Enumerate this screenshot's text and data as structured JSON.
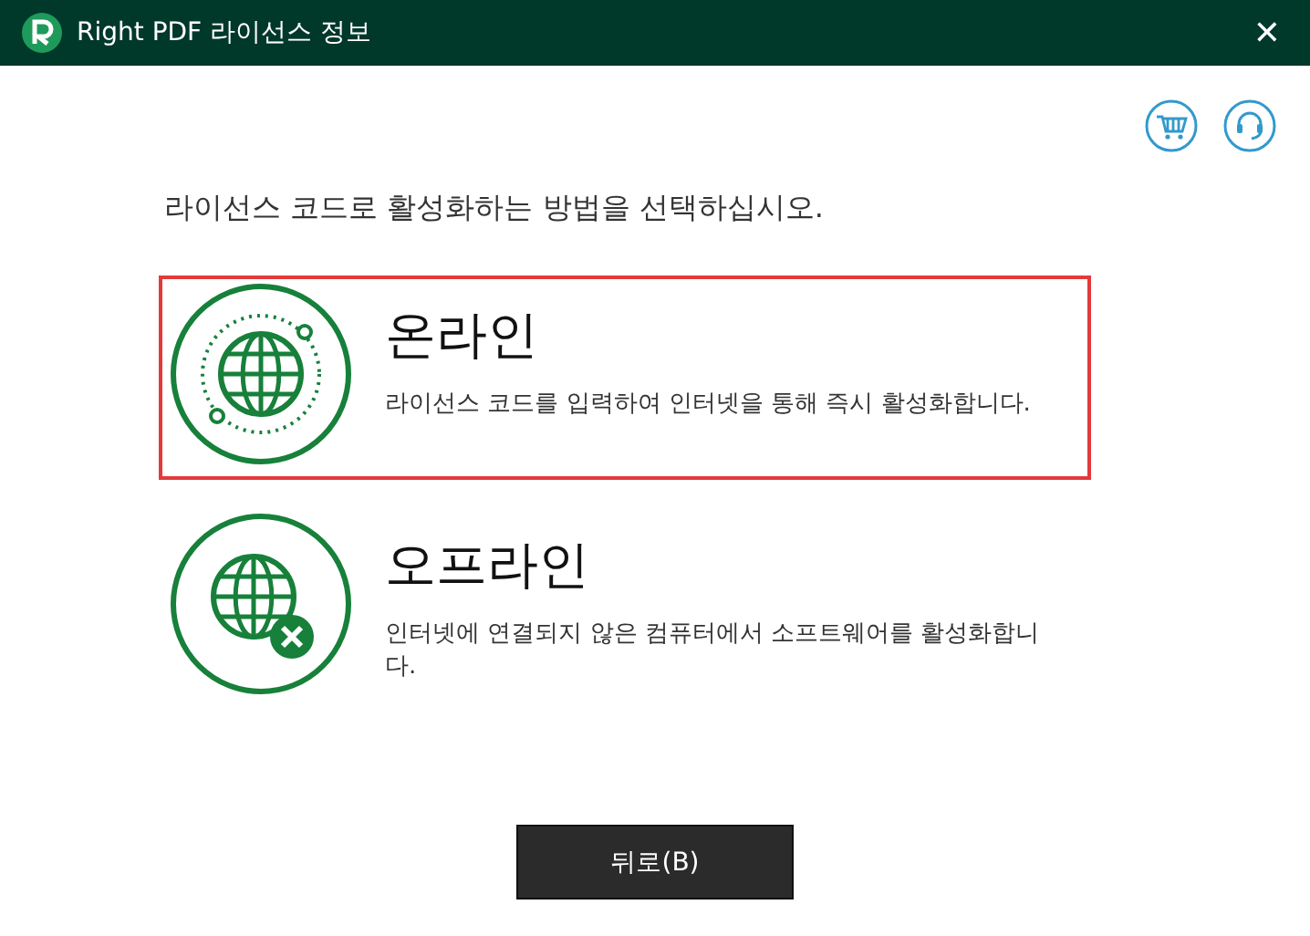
{
  "window": {
    "title": "Right PDF 라이선스 정보",
    "close": "✕"
  },
  "instruction": "라이선스 코드로 활성화하는 방법을 선택하십시오.",
  "options": [
    {
      "kind": "online",
      "title": "온라인",
      "description": "라이선스 코드를 입력하여 인터넷을 통해 즉시 활성화합니다.",
      "selected": true
    },
    {
      "kind": "offline",
      "title": "오프라인",
      "description": "인터넷에 연결되지 않은 컴퓨터에서 소프트웨어를 활성화합니다.",
      "selected": false
    }
  ],
  "buttons": [
    "뒤로(B)"
  ]
}
